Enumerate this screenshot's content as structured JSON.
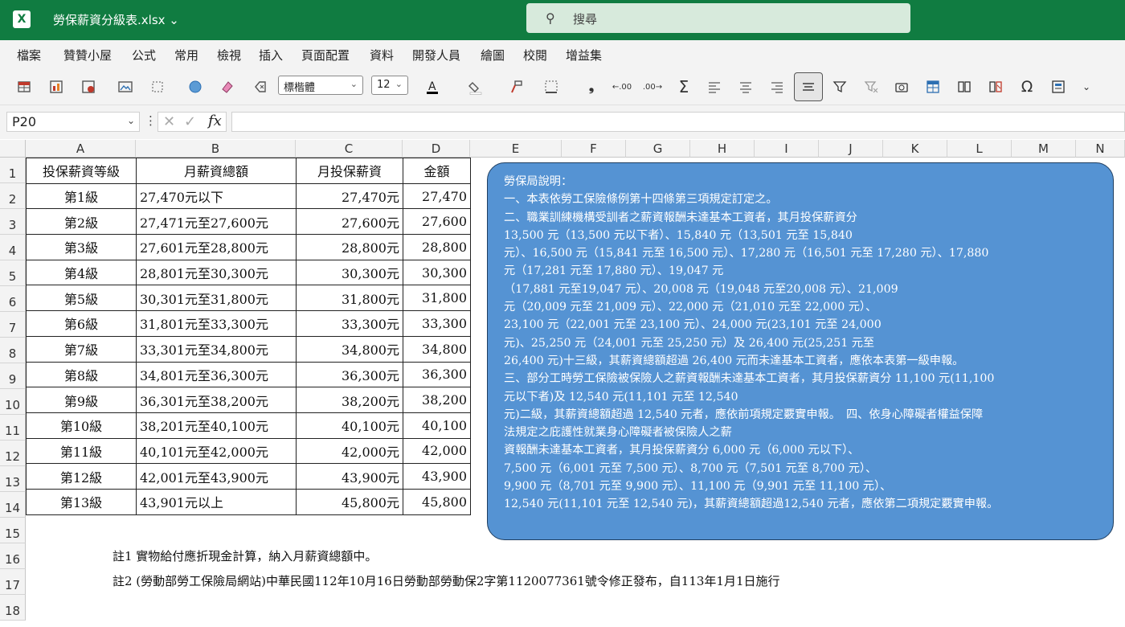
{
  "app": {
    "filename": "勞保薪資分級表.xlsx",
    "search_placeholder": "搜尋"
  },
  "menu": [
    "檔案",
    "贊贊小屋",
    "公式",
    "常用",
    "檢視",
    "插入",
    "頁面配置",
    "資料",
    "開發人員",
    "繪圖",
    "校閱",
    "增益集"
  ],
  "toolbar": {
    "font_name": "標楷體",
    "font_size": "12"
  },
  "formula_bar": {
    "name_box": "P20",
    "fx": "fx",
    "formula": ""
  },
  "columns": [
    "A",
    "B",
    "C",
    "D",
    "E",
    "F",
    "G",
    "H",
    "I",
    "J",
    "K",
    "L",
    "M",
    "N"
  ],
  "rows": [
    "1",
    "2",
    "3",
    "4",
    "5",
    "6",
    "7",
    "8",
    "9",
    "10",
    "11",
    "12",
    "13",
    "14",
    "15",
    "16",
    "17",
    "18"
  ],
  "table": {
    "headers": [
      "投保薪資等級",
      "月薪資總額",
      "月投保薪資",
      "金額"
    ],
    "rows": [
      [
        "第1級",
        "27,470元以下",
        "27,470元",
        "27,470"
      ],
      [
        "第2級",
        "27,471元至27,600元",
        "27,600元",
        "27,600"
      ],
      [
        "第3級",
        "27,601元至28,800元",
        "28,800元",
        "28,800"
      ],
      [
        "第4級",
        "28,801元至30,300元",
        "30,300元",
        "30,300"
      ],
      [
        "第5級",
        "30,301元至31,800元",
        "31,800元",
        "31,800"
      ],
      [
        "第6級",
        "31,801元至33,300元",
        "33,300元",
        "33,300"
      ],
      [
        "第7級",
        "33,301元至34,800元",
        "34,800元",
        "34,800"
      ],
      [
        "第8級",
        "34,801元至36,300元",
        "36,300元",
        "36,300"
      ],
      [
        "第9級",
        "36,301元至38,200元",
        "38,200元",
        "38,200"
      ],
      [
        "第10級",
        "38,201元至40,100元",
        "40,100元",
        "40,100"
      ],
      [
        "第11級",
        "40,101元至42,000元",
        "42,000元",
        "42,000"
      ],
      [
        "第12級",
        "42,001元至43,900元",
        "43,900元",
        "43,900"
      ],
      [
        "第13級",
        "43,901元以上",
        "45,800元",
        "45,800"
      ]
    ]
  },
  "note_box": {
    "lines": [
      "勞保局說明：",
      "一、本表依勞工保險條例第十四條第三項規定訂定之。",
      "二、職業訓練機構受訓者之薪資報酬未達基本工資者，其月投保薪資分",
      "13,500 元（13,500 元以下者）、15,840 元（13,501 元至 15,840",
      "元）、16,500 元（15,841 元至 16,500 元）、17,280 元（16,501 元至 17,280 元）、17,880",
      "元（17,281 元至 17,880 元）、19,047 元",
      "（17,881 元至19,047 元）、20,008 元（19,048 元至20,008 元）、21,009",
      "元（20,009 元至 21,009 元）、22,000 元（21,010 元至 22,000 元）、",
      "23,100 元（22,001 元至 23,100 元）、24,000 元(23,101 元至 24,000",
      "元)、25,250 元（24,001 元至 25,250 元）及 26,400 元(25,251 元至",
      "26,400 元)十三級，其薪資總額超過 26,400 元而未達基本工資者，應依本表第一級申報。",
      "三、部分工時勞工保險被保險人之薪資報酬未達基本工資者，其月投保薪資分 11,100 元(11,100",
      "元以下者)及 12,540 元(11,101 元至 12,540",
      "元)二級，其薪資總額超過 12,540 元者，應依前項規定覈實申報。　四、依身心障礙者權益保障",
      "法規定之庇護性就業身心障礙者被保險人之薪",
      "資報酬未達基本工資者，其月投保薪資分 6,000 元（6,000 元以下）、",
      "7,500 元（6,001 元至 7,500 元）、8,700 元（7,501 元至 8,700 元）、",
      "9,900 元（8,701 元至 9,900 元）、11,100 元（9,901 元至 11,100 元）、",
      "12,540 元(11,101 元至 12,540 元)，其薪資總額超過12,540 元者，應依第二項規定覈實申報。"
    ]
  },
  "footnotes": {
    "note1": "註1 實物給付應折現金計算，納入月薪資總額中。",
    "note2": "註2 (勞動部勞工保險局網站)中華民國112年10月16日勞動部勞動保2字第1120077361號令修正發布，自113年1月1日施行"
  }
}
